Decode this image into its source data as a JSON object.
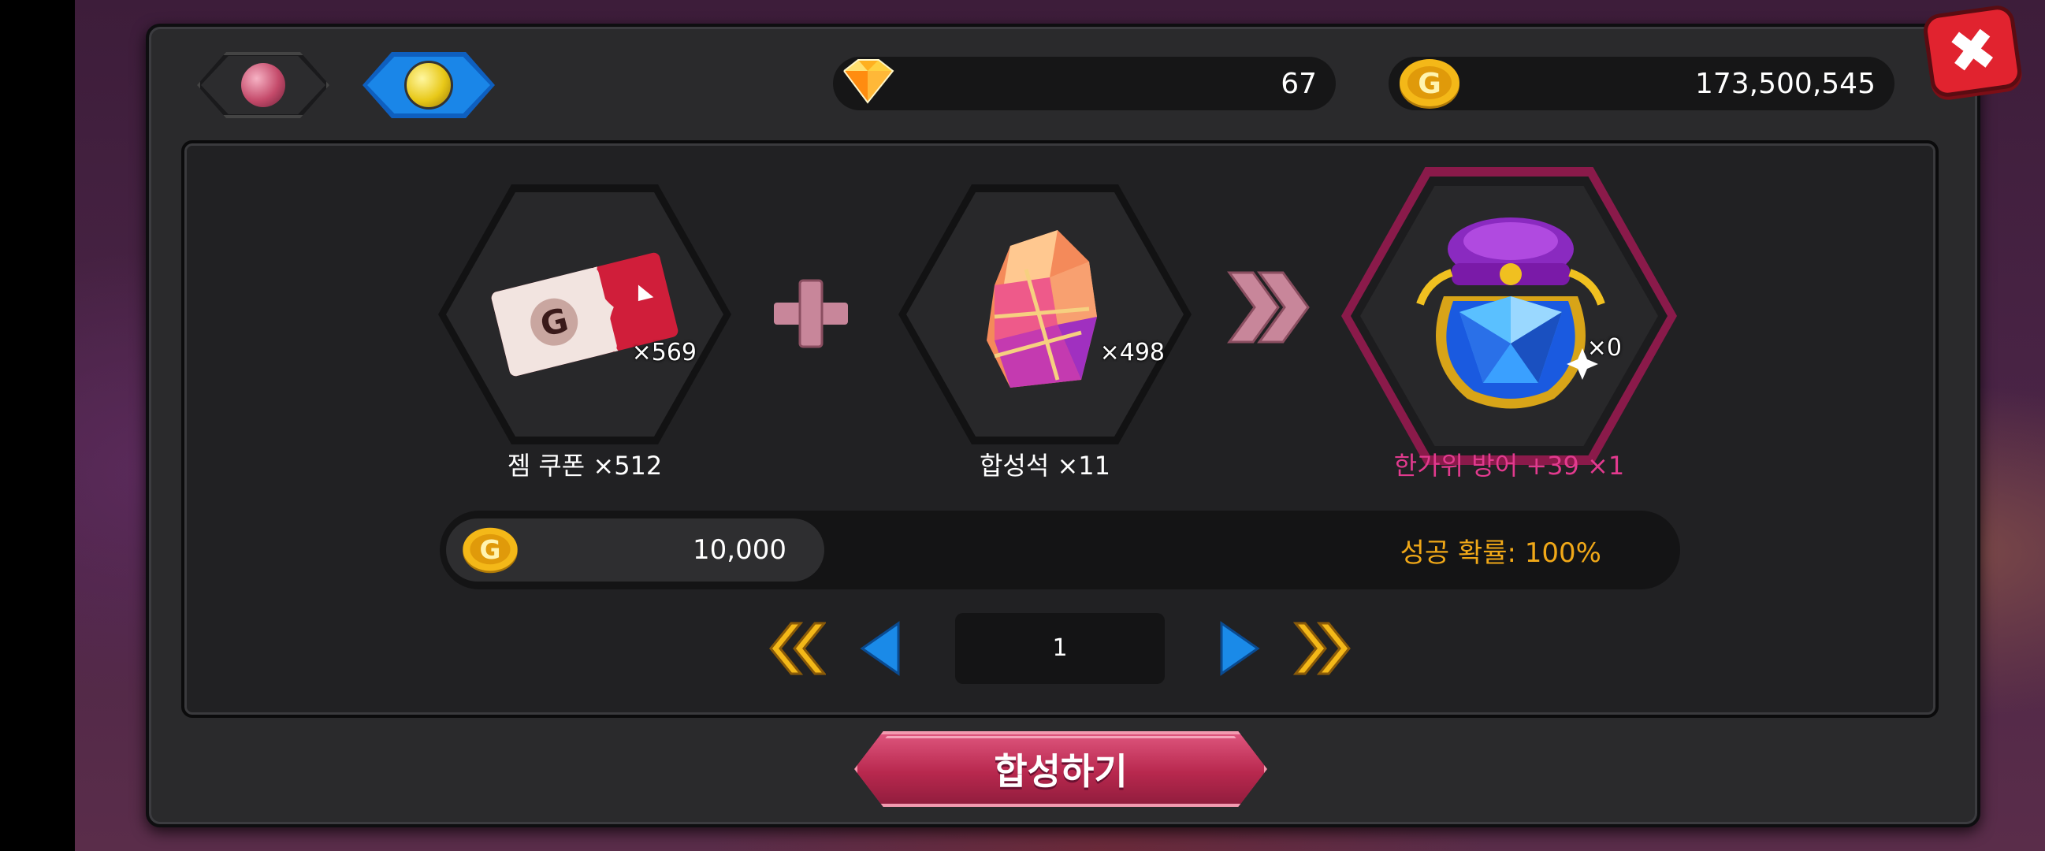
{
  "currencies": {
    "gems": "67",
    "gold": "173,500,545"
  },
  "tabs": [
    {
      "icon": "gem-ore-icon"
    },
    {
      "icon": "potion-icon"
    }
  ],
  "recipe": {
    "ingredient1": {
      "icon": "gold-coupon-icon",
      "count": "×569",
      "label": "젬 쿠폰 ×512"
    },
    "ingredient2": {
      "icon": "synthesis-stone-icon",
      "count": "×498",
      "label": "합성석 ×11"
    },
    "result": {
      "icon": "defense-pouch-icon",
      "count": "×0",
      "label": "한가위 방어 +39 ×1"
    }
  },
  "cost": {
    "value": "10,000",
    "success_rate": "성공 확률: 100%"
  },
  "pager": {
    "page": "1"
  },
  "synthesize_button": "합성하기",
  "colors": {
    "result_label": "#e23a8e",
    "success_rate": "#f0a818",
    "accent_button": "#c2325e",
    "tab_active": "#1a86e8"
  }
}
